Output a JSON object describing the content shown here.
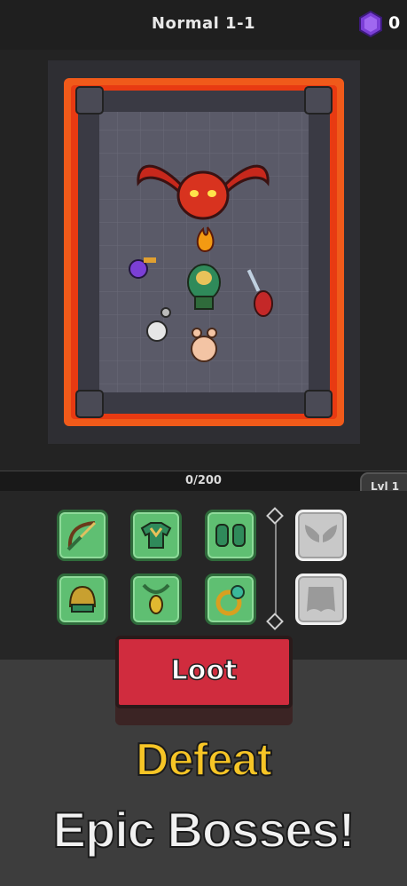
{
  "header": {
    "stage_title": "Normal 1-1",
    "gem_count": "0",
    "gem_icon": "purple-gem-icon"
  },
  "progress": {
    "text": "0/200",
    "value": 0,
    "max": 200,
    "level_label": "Lvl 1"
  },
  "equipment": {
    "slots": [
      {
        "name": "bow",
        "icon": "bow-icon"
      },
      {
        "name": "armor",
        "icon": "chest-armor-icon"
      },
      {
        "name": "gloves",
        "icon": "gloves-icon"
      },
      {
        "name": "helmet",
        "icon": "helmet-icon"
      },
      {
        "name": "amulet",
        "icon": "amulet-icon"
      },
      {
        "name": "ring",
        "icon": "ring-icon"
      }
    ],
    "locked_slots": [
      {
        "name": "wings",
        "icon": "wings-icon"
      },
      {
        "name": "cape",
        "icon": "cape-icon"
      }
    ]
  },
  "actions": {
    "loot_label": "Loot"
  },
  "promo": {
    "line1": "Defeat",
    "line2": "Epic Bosses!"
  },
  "colors": {
    "lava": "#f05a1a",
    "slot_green": "#5fbf72",
    "loot_red": "#d02c3e",
    "promo_yellow": "#f6c526",
    "gem_purple": "#7b3fd6"
  }
}
